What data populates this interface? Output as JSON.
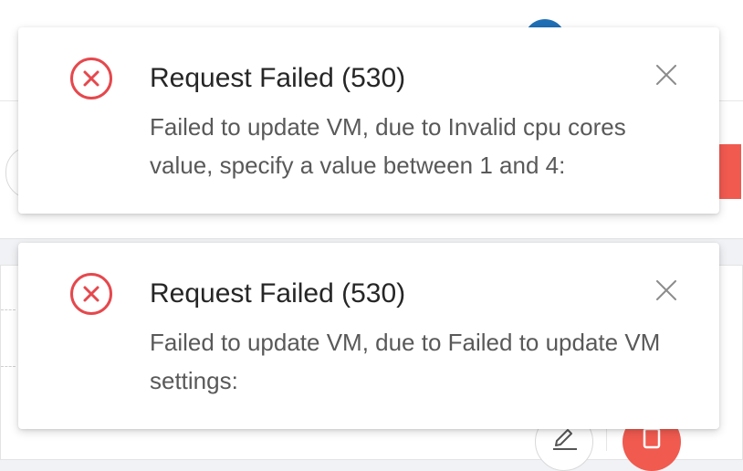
{
  "colors": {
    "error": "#e5484d",
    "title_text": "#262626",
    "body_text": "#595959",
    "close_icon": "#8c8c8c",
    "avatar": "#1f6fb5",
    "danger_button": "#f05a4f"
  },
  "icons": {
    "error": "close-circle-icon",
    "close": "close-icon",
    "edit": "edit-icon",
    "delete": "delete-icon"
  },
  "notifications": [
    {
      "title": "Request Failed (530)",
      "message": "Failed to update VM, due to Invalid cpu cores value, specify a value between 1 and 4:"
    },
    {
      "title": "Request Failed (530)",
      "message": "Failed to update VM, due to Failed to update VM settings:"
    }
  ]
}
